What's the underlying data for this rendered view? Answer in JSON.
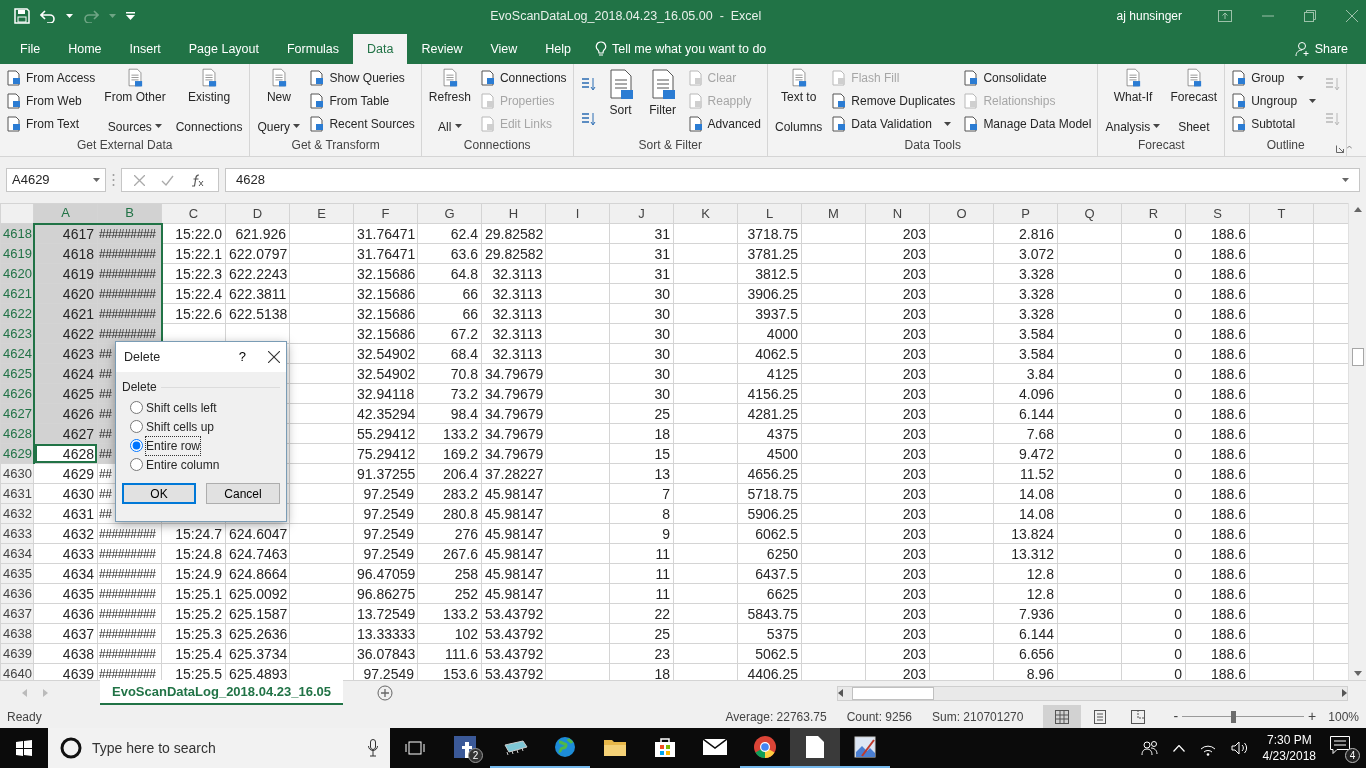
{
  "title_bar": {
    "title": "EvoScanDataLog_2018.04.23_16.05.00  -  Excel",
    "user": "aj hunsinger"
  },
  "tabs": [
    {
      "label": "File",
      "selected": false
    },
    {
      "label": "Home",
      "selected": false
    },
    {
      "label": "Insert",
      "selected": false
    },
    {
      "label": "Page Layout",
      "selected": false
    },
    {
      "label": "Formulas",
      "selected": false
    },
    {
      "label": "Data",
      "selected": true
    },
    {
      "label": "Review",
      "selected": false
    },
    {
      "label": "View",
      "selected": false
    },
    {
      "label": "Help",
      "selected": false
    }
  ],
  "tell_me": {
    "placeholder": "Tell me what you want to do"
  },
  "share": "Share",
  "ribbon_groups": [
    {
      "label": "Get External Data",
      "columns": [
        {
          "kind": "stack",
          "items": [
            {
              "label": "From Access",
              "disabled": false
            },
            {
              "label": "From Web",
              "disabled": false
            },
            {
              "label": "From Text",
              "disabled": false
            }
          ]
        },
        {
          "kind": "large",
          "lines": [
            "From Other",
            "Sources"
          ],
          "dropdown": true,
          "disabled": false
        },
        {
          "kind": "large",
          "lines": [
            "Existing",
            "Connections"
          ],
          "disabled": false
        }
      ]
    },
    {
      "label": "Get & Transform",
      "columns": [
        {
          "kind": "large",
          "lines": [
            "New",
            "Query"
          ],
          "dropdown": true,
          "disabled": false
        },
        {
          "kind": "stack",
          "items": [
            {
              "label": "Show Queries",
              "disabled": false
            },
            {
              "label": "From Table",
              "disabled": false
            },
            {
              "label": "Recent Sources",
              "disabled": false
            }
          ]
        }
      ]
    },
    {
      "label": "Connections",
      "columns": [
        {
          "kind": "large",
          "lines": [
            "Refresh",
            "All"
          ],
          "dropdown": true,
          "disabled": false
        },
        {
          "kind": "stack",
          "items": [
            {
              "label": "Connections",
              "disabled": false
            },
            {
              "label": "Properties",
              "disabled": true
            },
            {
              "label": "Edit Links",
              "disabled": true
            }
          ]
        }
      ]
    },
    {
      "label": "Sort & Filter",
      "columns": [
        {
          "kind": "icons",
          "items": [
            {
              "disabled": false
            },
            {
              "disabled": false
            }
          ]
        },
        {
          "kind": "large",
          "lines": [
            "Sort"
          ],
          "disabled": false
        },
        {
          "kind": "large",
          "lines": [
            "Filter"
          ],
          "disabled": false
        },
        {
          "kind": "stack",
          "items": [
            {
              "label": "Clear",
              "disabled": true
            },
            {
              "label": "Reapply",
              "disabled": true
            },
            {
              "label": "Advanced",
              "disabled": false
            }
          ]
        }
      ]
    },
    {
      "label": "Data Tools",
      "columns": [
        {
          "kind": "large",
          "lines": [
            "Text to",
            "Columns"
          ],
          "disabled": false
        },
        {
          "kind": "stack",
          "items": [
            {
              "label": "Flash Fill",
              "disabled": true
            },
            {
              "label": "Remove Duplicates",
              "disabled": false
            },
            {
              "label": "Data Validation",
              "disabled": false,
              "dropdown": true
            }
          ]
        },
        {
          "kind": "stack",
          "items": [
            {
              "label": "Consolidate",
              "disabled": false
            },
            {
              "label": "Relationships",
              "disabled": true
            },
            {
              "label": "Manage Data Model",
              "disabled": false
            }
          ]
        }
      ]
    },
    {
      "label": "Forecast",
      "columns": [
        {
          "kind": "large",
          "lines": [
            "What-If",
            "Analysis"
          ],
          "dropdown": true,
          "disabled": false
        },
        {
          "kind": "large",
          "lines": [
            "Forecast",
            "Sheet"
          ],
          "disabled": false
        }
      ]
    },
    {
      "label": "Outline",
      "launcher": true,
      "columns": [
        {
          "kind": "stack",
          "items": [
            {
              "label": "Group",
              "disabled": false,
              "dropdown": true
            },
            {
              "label": "Ungroup",
              "disabled": false,
              "dropdown": true
            },
            {
              "label": "Subtotal",
              "disabled": false
            }
          ]
        },
        {
          "kind": "icons",
          "items": [
            {
              "disabled": true
            },
            {
              "disabled": true
            }
          ]
        }
      ]
    }
  ],
  "formula_bar": {
    "name_box": "A4629",
    "value": "4628"
  },
  "columns": [
    {
      "label": "A",
      "selected": true
    },
    {
      "label": "B",
      "selected": true
    },
    {
      "label": "C",
      "selected": false
    },
    {
      "label": "D",
      "selected": false
    },
    {
      "label": "E",
      "selected": false
    },
    {
      "label": "F",
      "selected": false
    },
    {
      "label": "G",
      "selected": false
    },
    {
      "label": "H",
      "selected": false
    },
    {
      "label": "I",
      "selected": false
    },
    {
      "label": "J",
      "selected": false
    },
    {
      "label": "K",
      "selected": false
    },
    {
      "label": "L",
      "selected": false
    },
    {
      "label": "M",
      "selected": false
    },
    {
      "label": "N",
      "selected": false
    },
    {
      "label": "O",
      "selected": false
    },
    {
      "label": "P",
      "selected": false
    },
    {
      "label": "Q",
      "selected": false
    },
    {
      "label": "R",
      "selected": false
    },
    {
      "label": "S",
      "selected": false
    },
    {
      "label": "T",
      "selected": false
    }
  ],
  "rows": [
    {
      "header": "4618",
      "selected": true,
      "active": false,
      "cells": [
        "4617",
        "#########",
        "15:22.0",
        "621.926",
        null,
        "31.76471",
        "62.4",
        "29.82582",
        null,
        "31",
        null,
        "3718.75",
        null,
        "203",
        null,
        "2.816",
        null,
        "0",
        "188.6",
        null
      ]
    },
    {
      "header": "4619",
      "selected": true,
      "active": false,
      "cells": [
        "4618",
        "#########",
        "15:22.1",
        "622.0797",
        null,
        "31.76471",
        "63.6",
        "29.82582",
        null,
        "31",
        null,
        "3781.25",
        null,
        "203",
        null,
        "3.072",
        null,
        "0",
        "188.6",
        null
      ]
    },
    {
      "header": "4620",
      "selected": true,
      "active": false,
      "cells": [
        "4619",
        "#########",
        "15:22.3",
        "622.2243",
        null,
        "32.15686",
        "64.8",
        "32.3113",
        null,
        "31",
        null,
        "3812.5",
        null,
        "203",
        null,
        "3.328",
        null,
        "0",
        "188.6",
        null
      ]
    },
    {
      "header": "4621",
      "selected": true,
      "active": false,
      "cells": [
        "4620",
        "#########",
        "15:22.4",
        "622.3811",
        null,
        "32.15686",
        "66",
        "32.3113",
        null,
        "30",
        null,
        "3906.25",
        null,
        "203",
        null,
        "3.328",
        null,
        "0",
        "188.6",
        null
      ]
    },
    {
      "header": "4622",
      "selected": true,
      "active": false,
      "cells": [
        "4621",
        "#########",
        "15:22.6",
        "622.5138",
        null,
        "32.15686",
        "66",
        "32.3113",
        null,
        "30",
        null,
        "3937.5",
        null,
        "203",
        null,
        "3.328",
        null,
        "0",
        "188.6",
        null
      ]
    },
    {
      "header": "4623",
      "selected": true,
      "active": false,
      "cells": [
        "4622",
        "#########",
        null,
        null,
        null,
        "32.15686",
        "67.2",
        "32.3113",
        null,
        "30",
        null,
        "4000",
        null,
        "203",
        null,
        "3.584",
        null,
        "0",
        "188.6",
        null
      ]
    },
    {
      "header": "4624",
      "selected": true,
      "active": false,
      "cells": [
        "4623",
        "##",
        null,
        null,
        null,
        "32.54902",
        "68.4",
        "32.3113",
        null,
        "30",
        null,
        "4062.5",
        null,
        "203",
        null,
        "3.584",
        null,
        "0",
        "188.6",
        null
      ]
    },
    {
      "header": "4625",
      "selected": true,
      "active": false,
      "cells": [
        "4624",
        "##",
        null,
        null,
        null,
        "32.54902",
        "70.8",
        "34.79679",
        null,
        "30",
        null,
        "4125",
        null,
        "203",
        null,
        "3.84",
        null,
        "0",
        "188.6",
        null
      ]
    },
    {
      "header": "4626",
      "selected": true,
      "active": false,
      "cells": [
        "4625",
        "##",
        null,
        null,
        null,
        "32.94118",
        "73.2",
        "34.79679",
        null,
        "30",
        null,
        "4156.25",
        null,
        "203",
        null,
        "4.096",
        null,
        "0",
        "188.6",
        null
      ]
    },
    {
      "header": "4627",
      "selected": true,
      "active": false,
      "cells": [
        "4626",
        "##",
        null,
        null,
        null,
        "42.35294",
        "98.4",
        "34.79679",
        null,
        "25",
        null,
        "4281.25",
        null,
        "203",
        null,
        "6.144",
        null,
        "0",
        "188.6",
        null
      ]
    },
    {
      "header": "4628",
      "selected": true,
      "active": false,
      "cells": [
        "4627",
        "##",
        null,
        null,
        null,
        "55.29412",
        "133.2",
        "34.79679",
        null,
        "18",
        null,
        "4375",
        null,
        "203",
        null,
        "7.68",
        null,
        "0",
        "188.6",
        null
      ]
    },
    {
      "header": "4629",
      "selected": true,
      "active": true,
      "cells": [
        "4628",
        "##",
        null,
        null,
        null,
        "75.29412",
        "169.2",
        "34.79679",
        null,
        "15",
        null,
        "4500",
        null,
        "203",
        null,
        "9.472",
        null,
        "0",
        "188.6",
        null
      ]
    },
    {
      "header": "4630",
      "selected": false,
      "active": false,
      "cells": [
        "4629",
        "##",
        null,
        null,
        null,
        "91.37255",
        "206.4",
        "37.28227",
        null,
        "13",
        null,
        "4656.25",
        null,
        "203",
        null,
        "11.52",
        null,
        "0",
        "188.6",
        null
      ]
    },
    {
      "header": "4631",
      "selected": false,
      "active": false,
      "cells": [
        "4630",
        "##",
        null,
        null,
        null,
        "97.2549",
        "283.2",
        "45.98147",
        null,
        "7",
        null,
        "5718.75",
        null,
        "203",
        null,
        "14.08",
        null,
        "0",
        "188.6",
        null
      ]
    },
    {
      "header": "4632",
      "selected": false,
      "active": false,
      "cells": [
        "4631",
        "##",
        null,
        null,
        null,
        "97.2549",
        "280.8",
        "45.98147",
        null,
        "8",
        null,
        "5906.25",
        null,
        "203",
        null,
        "14.08",
        null,
        "0",
        "188.6",
        null
      ]
    },
    {
      "header": "4633",
      "selected": false,
      "active": false,
      "cells": [
        "4632",
        "#########",
        "15:24.7",
        "624.6047",
        null,
        "97.2549",
        "276",
        "45.98147",
        null,
        "9",
        null,
        "6062.5",
        null,
        "203",
        null,
        "13.824",
        null,
        "0",
        "188.6",
        null
      ]
    },
    {
      "header": "4634",
      "selected": false,
      "active": false,
      "cells": [
        "4633",
        "#########",
        "15:24.8",
        "624.7463",
        null,
        "97.2549",
        "267.6",
        "45.98147",
        null,
        "11",
        null,
        "6250",
        null,
        "203",
        null,
        "13.312",
        null,
        "0",
        "188.6",
        null
      ]
    },
    {
      "header": "4635",
      "selected": false,
      "active": false,
      "cells": [
        "4634",
        "#########",
        "15:24.9",
        "624.8664",
        null,
        "96.47059",
        "258",
        "45.98147",
        null,
        "11",
        null,
        "6437.5",
        null,
        "203",
        null,
        "12.8",
        null,
        "0",
        "188.6",
        null
      ]
    },
    {
      "header": "4636",
      "selected": false,
      "active": false,
      "cells": [
        "4635",
        "#########",
        "15:25.1",
        "625.0092",
        null,
        "96.86275",
        "252",
        "45.98147",
        null,
        "11",
        null,
        "6625",
        null,
        "203",
        null,
        "12.8",
        null,
        "0",
        "188.6",
        null
      ]
    },
    {
      "header": "4637",
      "selected": false,
      "active": false,
      "cells": [
        "4636",
        "#########",
        "15:25.2",
        "625.1587",
        null,
        "13.72549",
        "133.2",
        "53.43792",
        null,
        "22",
        null,
        "5843.75",
        null,
        "203",
        null,
        "7.936",
        null,
        "0",
        "188.6",
        null
      ]
    },
    {
      "header": "4638",
      "selected": false,
      "active": false,
      "cells": [
        "4637",
        "#########",
        "15:25.3",
        "625.2636",
        null,
        "13.33333",
        "102",
        "53.43792",
        null,
        "25",
        null,
        "5375",
        null,
        "203",
        null,
        "6.144",
        null,
        "0",
        "188.6",
        null
      ]
    },
    {
      "header": "4639",
      "selected": false,
      "active": false,
      "cells": [
        "4638",
        "#########",
        "15:25.4",
        "625.3734",
        null,
        "36.07843",
        "111.6",
        "53.43792",
        null,
        "23",
        null,
        "5062.5",
        null,
        "203",
        null,
        "6.656",
        null,
        "0",
        "188.6",
        null
      ]
    },
    {
      "header": "4640",
      "selected": false,
      "active": false,
      "cells": [
        "4639",
        "#########",
        "15:25.5",
        "625.4893",
        null,
        "97.2549",
        "153.6",
        "53.43792",
        null,
        "18",
        null,
        "4406.25",
        null,
        "203",
        null,
        "8.96",
        null,
        "0",
        "188.6",
        null
      ]
    }
  ],
  "dialog": {
    "title": "Delete",
    "help": "?",
    "group": "Delete",
    "options": [
      {
        "label": "Shift cells left",
        "selected": false
      },
      {
        "label": "Shift cells up",
        "selected": false
      },
      {
        "label": "Entire row",
        "selected": true
      },
      {
        "label": "Entire column",
        "selected": false
      }
    ],
    "buttons": [
      {
        "label": "OK",
        "default": true
      },
      {
        "label": "Cancel",
        "default": false
      }
    ]
  },
  "sheet_tabs": [
    {
      "label": "EvoScanDataLog_2018.04.23_16.05",
      "selected": true
    }
  ],
  "status_bar": {
    "mode": "Ready",
    "stats": [
      "Average: 22763.75",
      "Count: 9256",
      "Sum: 210701270"
    ],
    "views": [
      {
        "selected": true
      },
      {
        "selected": false
      },
      {
        "selected": false
      }
    ],
    "zoom": {
      "minus": "-",
      "plus": "+",
      "level": 0.42,
      "reading": "100%"
    }
  },
  "taskbar": {
    "search": {
      "placeholder": "Type here to search"
    },
    "apps": [
      {
        "kind": "social",
        "running": false,
        "active": false,
        "badge": "2"
      },
      {
        "kind": "chip",
        "running": true,
        "active": false
      },
      {
        "kind": "globe",
        "running": true,
        "active": false
      },
      {
        "kind": "folder",
        "running": false,
        "active": false
      },
      {
        "kind": "store",
        "running": false,
        "active": false
      },
      {
        "kind": "mail",
        "running": false,
        "active": false
      },
      {
        "kind": "browser",
        "running": true,
        "active": false
      },
      {
        "kind": "document",
        "running": true,
        "active": true
      },
      {
        "kind": "paint",
        "running": true,
        "active": false
      }
    ],
    "clock": {
      "time": "7:30 PM",
      "date": "4/23/2018"
    },
    "notifications": "4"
  }
}
